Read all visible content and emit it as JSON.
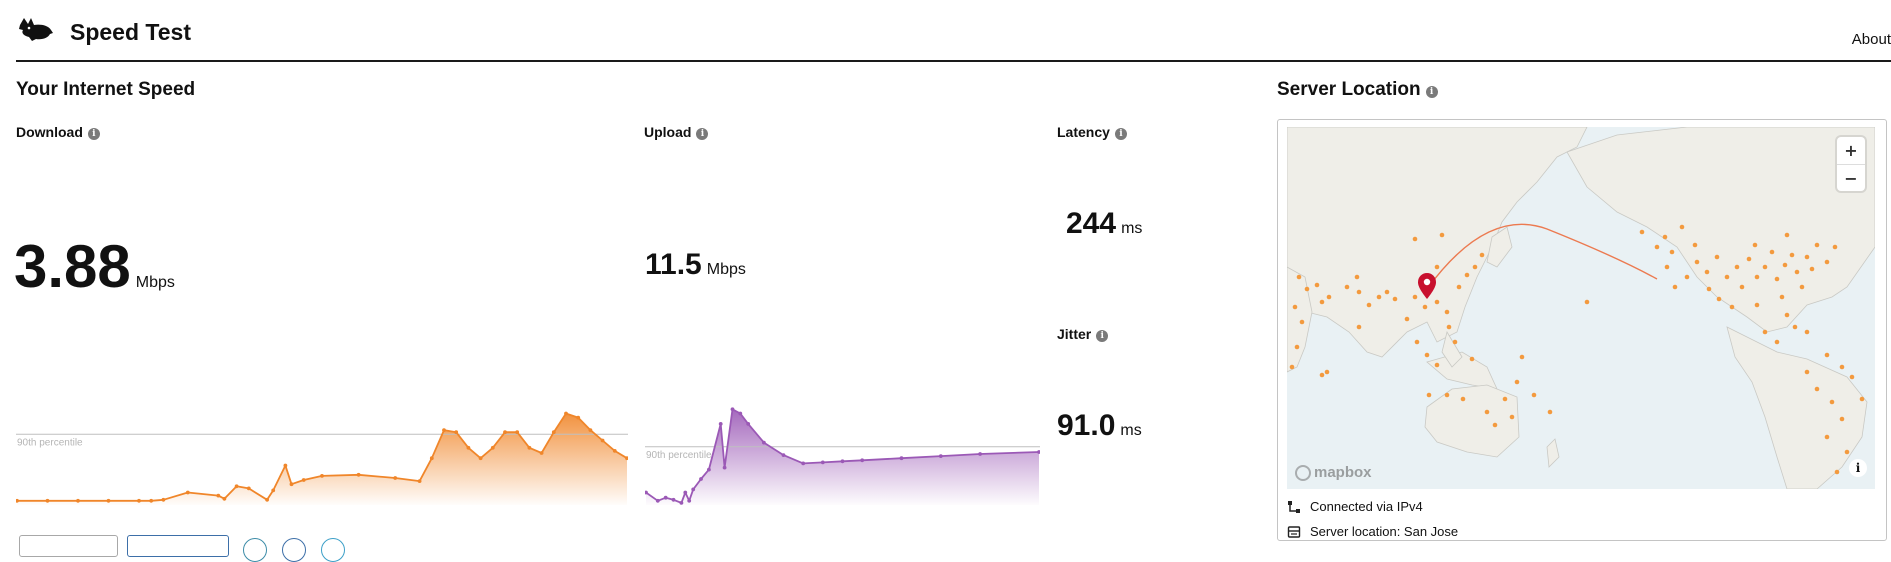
{
  "header": {
    "title": "Speed Test",
    "about_label": "About"
  },
  "speed": {
    "section_title": "Your Internet Speed",
    "download": {
      "label": "Download",
      "value": "3.88",
      "unit": "Mbps",
      "percentile_label": "90th percentile"
    },
    "upload": {
      "label": "Upload",
      "value": "11.5",
      "unit": "Mbps",
      "percentile_label": "90th percentile"
    },
    "latency": {
      "label": "Latency",
      "value": "244",
      "unit": "ms"
    },
    "jitter": {
      "label": "Jitter",
      "value": "91.0",
      "unit": "ms"
    }
  },
  "server": {
    "section_title": "Server Location",
    "connected_via": "Connected via IPv4",
    "server_location": "Server location: San Jose",
    "map_logo": "mapbox",
    "zoom_in": "+",
    "zoom_out": "−"
  },
  "colors": {
    "download": "#f0862a",
    "upload": "#9b59b6",
    "pin": "#c8102e",
    "server_dot": "#f39a3e"
  },
  "icons": {
    "logo": "rabbit-logo",
    "info": "info-icon",
    "connection": "network-icon",
    "server": "server-icon"
  },
  "chart_data": [
    {
      "type": "area",
      "series": [
        {
          "name": "Download",
          "x": [
            0,
            0.05,
            0.1,
            0.15,
            0.2,
            0.22,
            0.24,
            0.28,
            0.33,
            0.34,
            0.36,
            0.38,
            0.41,
            0.42,
            0.44,
            0.45,
            0.47,
            0.5,
            0.56,
            0.62,
            0.66,
            0.68,
            0.7,
            0.72,
            0.74,
            0.76,
            0.78,
            0.8,
            0.82,
            0.84,
            0.86,
            0.88,
            0.9,
            0.92,
            0.94,
            0.96,
            0.98,
            1.0
          ],
          "values": [
            0.04,
            0.04,
            0.04,
            0.04,
            0.04,
            0.04,
            0.05,
            0.12,
            0.09,
            0.06,
            0.18,
            0.16,
            0.05,
            0.14,
            0.38,
            0.2,
            0.24,
            0.28,
            0.29,
            0.26,
            0.23,
            0.45,
            0.72,
            0.7,
            0.55,
            0.45,
            0.55,
            0.7,
            0.7,
            0.55,
            0.5,
            0.7,
            0.88,
            0.84,
            0.72,
            0.62,
            0.52,
            0.45
          ]
        }
      ],
      "reference_line": {
        "label": "90th percentile",
        "value": 0.68
      }
    },
    {
      "type": "area",
      "series": [
        {
          "name": "Upload",
          "x": [
            0,
            0.03,
            0.05,
            0.07,
            0.09,
            0.1,
            0.11,
            0.12,
            0.14,
            0.16,
            0.19,
            0.2,
            0.22,
            0.24,
            0.26,
            0.3,
            0.35,
            0.4,
            0.45,
            0.5,
            0.55,
            0.65,
            0.75,
            0.85,
            1.0
          ],
          "values": [
            0.12,
            0.04,
            0.07,
            0.05,
            0.02,
            0.12,
            0.04,
            0.15,
            0.25,
            0.34,
            0.78,
            0.36,
            0.92,
            0.88,
            0.78,
            0.6,
            0.48,
            0.4,
            0.41,
            0.42,
            0.43,
            0.45,
            0.47,
            0.49,
            0.51
          ]
        }
      ],
      "reference_line": {
        "label": "90th percentile",
        "value": 0.56
      }
    }
  ]
}
